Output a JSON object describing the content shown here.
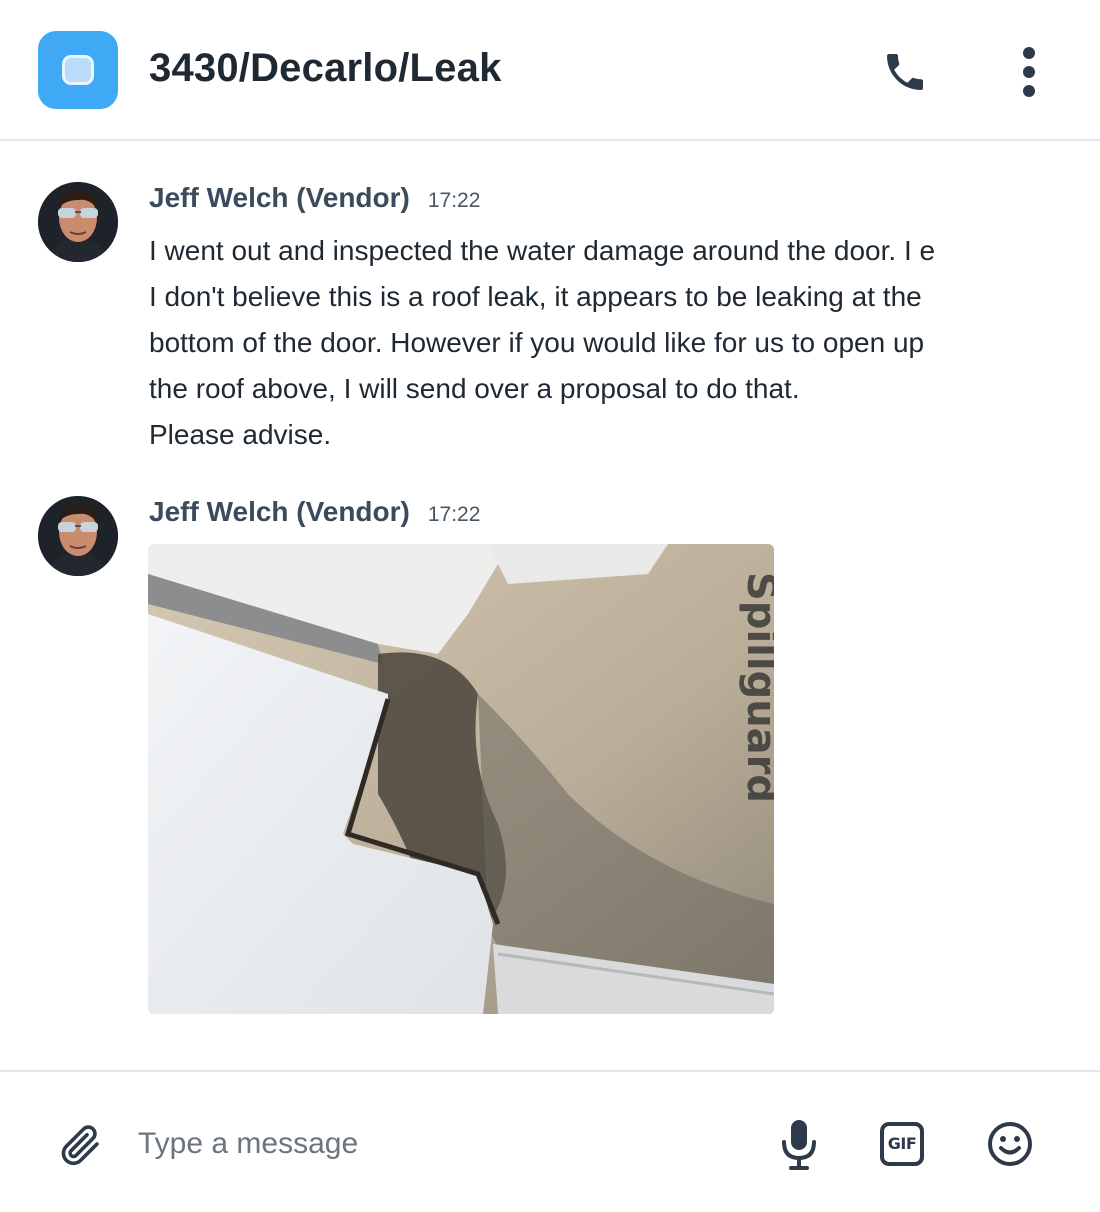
{
  "header": {
    "title": "3430/Decarlo/Leak",
    "channel_icon": "channel-square-icon",
    "accent_color": "#3fa9f5",
    "actions": [
      "phone-icon",
      "more-vertical-icon"
    ]
  },
  "messages": [
    {
      "author": "Jeff Welch (Vendor)",
      "time": "17:22",
      "lines": [
        "I went out and inspected the water damage around the door. I e",
        "I don't believe this is a roof leak, it appears to be leaking at the",
        "bottom of the door. However if you would like for us to open up",
        "the roof above, I will send over a proposal to do that.",
        "Please advise."
      ]
    },
    {
      "author": "Jeff Welch (Vendor)",
      "time": "17:22",
      "photo_text": "Spillguard"
    }
  ],
  "composer": {
    "placeholder": "Type a message",
    "value": "",
    "gif_label": "GIF",
    "icons": [
      "paperclip-icon",
      "microphone-icon",
      "gif-icon",
      "smiley-icon"
    ]
  }
}
